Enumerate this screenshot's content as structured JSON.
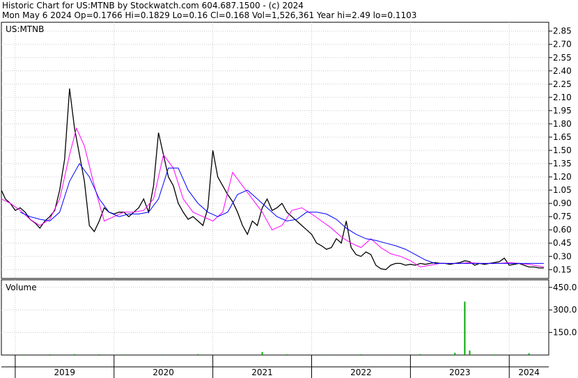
{
  "header": {
    "line1": "Historic Chart for US:MTNB by Stockwatch.com 604.687.1500 - (c) 2024",
    "line2": "Mon May  6 2024  Op=0.1766  Hi=0.1829  Lo=0.16  Cl=0.168  Vol=1,526,361  Year hi=2.49  lo=0.1103"
  },
  "chart_data": [
    {
      "type": "line",
      "title": "US:MTNB",
      "ylim": [
        0.05,
        2.95
      ],
      "yticks": [
        "2.85",
        "2.70",
        "2.55",
        "2.40",
        "2.25",
        "2.10",
        "1.95",
        "1.80",
        "1.65",
        "1.50",
        "1.35",
        "1.20",
        "1.05",
        "0.90",
        "0.75",
        "0.60",
        "0.45",
        "0.30",
        "0.15"
      ],
      "x_labels": [
        "2019",
        "2020",
        "2021",
        "2022",
        "2023",
        "2024"
      ],
      "grid": true,
      "series": [
        {
          "color": "#000000",
          "x": [
            2018.86,
            2018.9,
            2018.95,
            2019.0,
            2019.05,
            2019.1,
            2019.15,
            2019.2,
            2019.25,
            2019.3,
            2019.35,
            2019.4,
            2019.45,
            2019.5,
            2019.55,
            2019.6,
            2019.65,
            2019.7,
            2019.75,
            2019.8,
            2019.85,
            2019.9,
            2019.95,
            2020.0,
            2020.05,
            2020.1,
            2020.15,
            2020.2,
            2020.25,
            2020.3,
            2020.35,
            2020.4,
            2020.45,
            2020.5,
            2020.55,
            2020.6,
            2020.65,
            2020.7,
            2020.75,
            2020.8,
            2020.85,
            2020.9,
            2020.95,
            2021.0,
            2021.05,
            2021.1,
            2021.15,
            2021.2,
            2021.25,
            2021.3,
            2021.35,
            2021.4,
            2021.45,
            2021.5,
            2021.55,
            2021.6,
            2021.65,
            2021.7,
            2021.75,
            2021.8,
            2021.85,
            2021.9,
            2021.95,
            2022.0,
            2022.05,
            2022.1,
            2022.15,
            2022.2,
            2022.25,
            2022.3,
            2022.35,
            2022.4,
            2022.45,
            2022.5,
            2022.55,
            2022.6,
            2022.65,
            2022.7,
            2022.75,
            2022.8,
            2022.85,
            2022.9,
            2022.95,
            2023.0,
            2023.05,
            2023.1,
            2023.15,
            2023.2,
            2023.25,
            2023.3,
            2023.35,
            2023.4,
            2023.45,
            2023.5,
            2023.55,
            2023.6,
            2023.65,
            2023.7,
            2023.75,
            2023.8,
            2023.85,
            2023.9,
            2023.95,
            2024.0,
            2024.05,
            2024.1,
            2024.15,
            2024.2,
            2024.25,
            2024.3,
            2024.35
          ],
          "values": [
            1.05,
            0.95,
            0.9,
            0.82,
            0.85,
            0.8,
            0.72,
            0.68,
            0.62,
            0.7,
            0.75,
            0.82,
            1.05,
            1.4,
            2.2,
            1.75,
            1.45,
            1.15,
            0.65,
            0.58,
            0.7,
            0.85,
            0.8,
            0.78,
            0.8,
            0.8,
            0.75,
            0.8,
            0.85,
            0.95,
            0.8,
            1.1,
            1.7,
            1.45,
            1.2,
            1.1,
            0.9,
            0.8,
            0.72,
            0.75,
            0.7,
            0.65,
            0.85,
            1.5,
            1.2,
            1.1,
            1.0,
            0.92,
            0.8,
            0.65,
            0.55,
            0.7,
            0.65,
            0.85,
            0.95,
            0.82,
            0.85,
            0.9,
            0.8,
            0.75,
            0.7,
            0.65,
            0.6,
            0.55,
            0.45,
            0.42,
            0.38,
            0.4,
            0.5,
            0.45,
            0.7,
            0.4,
            0.32,
            0.3,
            0.35,
            0.32,
            0.2,
            0.16,
            0.15,
            0.2,
            0.22,
            0.22,
            0.2,
            0.21,
            0.2,
            0.22,
            0.21,
            0.22,
            0.23,
            0.22,
            0.22,
            0.21,
            0.22,
            0.23,
            0.25,
            0.24,
            0.2,
            0.22,
            0.21,
            0.22,
            0.23,
            0.24,
            0.28,
            0.2,
            0.21,
            0.22,
            0.2,
            0.18,
            0.18,
            0.17,
            0.168
          ]
        },
        {
          "color": "#ff00ff",
          "x": [
            2018.86,
            2018.95,
            2019.05,
            2019.15,
            2019.25,
            2019.35,
            2019.45,
            2019.55,
            2019.62,
            2019.7,
            2019.8,
            2019.9,
            2020.0,
            2020.1,
            2020.2,
            2020.3,
            2020.4,
            2020.5,
            2020.6,
            2020.7,
            2020.8,
            2020.9,
            2021.0,
            2021.1,
            2021.2,
            2021.3,
            2021.4,
            2021.5,
            2021.6,
            2021.7,
            2021.8,
            2021.9,
            2022.0,
            2022.1,
            2022.2,
            2022.3,
            2022.4,
            2022.5,
            2022.6,
            2022.7,
            2022.8,
            2022.9,
            2023.0,
            2023.1,
            2023.2,
            2023.3,
            2023.4,
            2023.5,
            2023.6,
            2023.7,
            2023.8,
            2023.9,
            2024.0,
            2024.1,
            2024.2,
            2024.3,
            2024.35
          ],
          "values": [
            0.95,
            0.9,
            0.82,
            0.72,
            0.65,
            0.72,
            0.95,
            1.45,
            1.75,
            1.55,
            1.1,
            0.7,
            0.75,
            0.8,
            0.8,
            0.82,
            0.95,
            1.45,
            1.3,
            0.95,
            0.8,
            0.75,
            0.7,
            0.8,
            1.25,
            1.1,
            0.95,
            0.8,
            0.6,
            0.65,
            0.82,
            0.85,
            0.78,
            0.7,
            0.62,
            0.52,
            0.45,
            0.4,
            0.5,
            0.4,
            0.33,
            0.3,
            0.25,
            0.18,
            0.2,
            0.22,
            0.22,
            0.22,
            0.23,
            0.22,
            0.22,
            0.22,
            0.23,
            0.22,
            0.21,
            0.19,
            0.18
          ]
        },
        {
          "color": "#0000ff",
          "x": [
            2019.05,
            2019.15,
            2019.25,
            2019.35,
            2019.45,
            2019.55,
            2019.65,
            2019.75,
            2019.85,
            2019.95,
            2020.05,
            2020.15,
            2020.25,
            2020.35,
            2020.45,
            2020.55,
            2020.65,
            2020.75,
            2020.85,
            2020.95,
            2021.05,
            2021.15,
            2021.25,
            2021.35,
            2021.45,
            2021.55,
            2021.65,
            2021.75,
            2021.85,
            2021.95,
            2022.05,
            2022.15,
            2022.25,
            2022.35,
            2022.45,
            2022.55,
            2022.65,
            2022.75,
            2022.85,
            2022.95,
            2023.05,
            2023.15,
            2023.25,
            2023.35,
            2023.45,
            2023.55,
            2023.65,
            2023.75,
            2023.85,
            2023.95,
            2024.05,
            2024.15,
            2024.25,
            2024.35
          ],
          "values": [
            0.8,
            0.75,
            0.72,
            0.7,
            0.8,
            1.15,
            1.35,
            1.2,
            0.95,
            0.8,
            0.75,
            0.78,
            0.78,
            0.8,
            0.95,
            1.3,
            1.3,
            1.05,
            0.9,
            0.8,
            0.75,
            0.8,
            1.0,
            1.05,
            0.95,
            0.85,
            0.75,
            0.7,
            0.72,
            0.8,
            0.8,
            0.78,
            0.72,
            0.62,
            0.55,
            0.5,
            0.48,
            0.45,
            0.42,
            0.38,
            0.32,
            0.26,
            0.22,
            0.22,
            0.22,
            0.22,
            0.22,
            0.22,
            0.22,
            0.22,
            0.22,
            0.22,
            0.22,
            0.22
          ]
        }
      ]
    },
    {
      "type": "bar",
      "title": "Volume",
      "ylim": [
        0,
        500
      ],
      "yticks": [
        "450.0",
        "300.0",
        "150.0"
      ],
      "x": [
        2019.1,
        2019.35,
        2019.6,
        2019.85,
        2020.1,
        2020.5,
        2020.85,
        2021.5,
        2021.75,
        2022.2,
        2022.5,
        2022.85,
        2023.1,
        2023.45,
        2023.55,
        2023.6,
        2023.85,
        2024.2
      ],
      "values": [
        4,
        5,
        6,
        5,
        4,
        4,
        6,
        20,
        5,
        4,
        5,
        4,
        6,
        15,
        355,
        30,
        4,
        12
      ]
    }
  ]
}
